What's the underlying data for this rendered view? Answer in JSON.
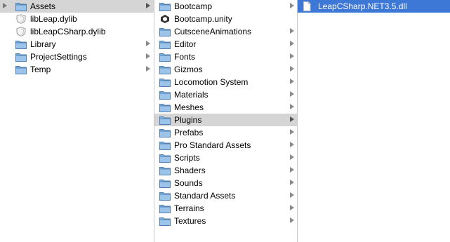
{
  "column1": {
    "items": [
      {
        "label": "Assets",
        "icon": "folder-icon",
        "has_arrow": true,
        "selected": "gray",
        "disclosure": true
      },
      {
        "label": "libLeap.dylib",
        "icon": "shield-file-icon",
        "has_arrow": false,
        "selected": "",
        "disclosure": false
      },
      {
        "label": "libLeapCSharp.dylib",
        "icon": "shield-file-icon",
        "has_arrow": false,
        "selected": "",
        "disclosure": false
      },
      {
        "label": "Library",
        "icon": "folder-icon",
        "has_arrow": true,
        "selected": "",
        "disclosure": false
      },
      {
        "label": "ProjectSettings",
        "icon": "folder-icon",
        "has_arrow": true,
        "selected": "",
        "disclosure": false
      },
      {
        "label": "Temp",
        "icon": "folder-icon",
        "has_arrow": true,
        "selected": "",
        "disclosure": false
      }
    ]
  },
  "column2": {
    "items": [
      {
        "label": "Bootcamp",
        "icon": "folder-icon",
        "has_arrow": true,
        "selected": ""
      },
      {
        "label": "Bootcamp.unity",
        "icon": "unity-scene-icon",
        "has_arrow": false,
        "selected": ""
      },
      {
        "label": "CutsceneAnimations",
        "icon": "folder-icon",
        "has_arrow": true,
        "selected": ""
      },
      {
        "label": "Editor",
        "icon": "folder-icon",
        "has_arrow": true,
        "selected": ""
      },
      {
        "label": "Fonts",
        "icon": "folder-icon",
        "has_arrow": true,
        "selected": ""
      },
      {
        "label": "Gizmos",
        "icon": "folder-icon",
        "has_arrow": true,
        "selected": ""
      },
      {
        "label": "Locomotion System",
        "icon": "folder-icon",
        "has_arrow": true,
        "selected": ""
      },
      {
        "label": "Materials",
        "icon": "folder-icon",
        "has_arrow": true,
        "selected": ""
      },
      {
        "label": "Meshes",
        "icon": "folder-icon",
        "has_arrow": true,
        "selected": ""
      },
      {
        "label": "Plugins",
        "icon": "folder-icon",
        "has_arrow": true,
        "selected": "gray"
      },
      {
        "label": "Prefabs",
        "icon": "folder-icon",
        "has_arrow": true,
        "selected": ""
      },
      {
        "label": "Pro Standard Assets",
        "icon": "folder-icon",
        "has_arrow": true,
        "selected": ""
      },
      {
        "label": "Scripts",
        "icon": "folder-icon",
        "has_arrow": true,
        "selected": ""
      },
      {
        "label": "Shaders",
        "icon": "folder-icon",
        "has_arrow": true,
        "selected": ""
      },
      {
        "label": "Sounds",
        "icon": "folder-icon",
        "has_arrow": true,
        "selected": ""
      },
      {
        "label": "Standard Assets",
        "icon": "folder-icon",
        "has_arrow": true,
        "selected": ""
      },
      {
        "label": "Terrains",
        "icon": "folder-icon",
        "has_arrow": true,
        "selected": ""
      },
      {
        "label": "Textures",
        "icon": "folder-icon",
        "has_arrow": true,
        "selected": ""
      }
    ]
  },
  "column3": {
    "items": [
      {
        "label": "LeapCSharp.NET3.5.dll",
        "icon": "document-icon",
        "has_arrow": false,
        "selected": "blue"
      }
    ]
  },
  "colors": {
    "selection_blue": "#3e78d7",
    "selection_gray": "#d5d5d5",
    "folder_blue": "#6d9fd1"
  }
}
